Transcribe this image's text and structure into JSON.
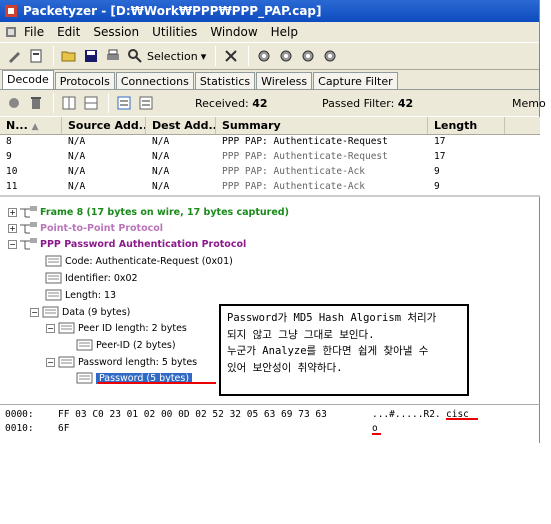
{
  "window": {
    "title": "Packetyzer - [D:₩Work₩PPP₩PPP_PAP.cap]"
  },
  "menu": {
    "items": [
      "File",
      "Edit",
      "Session",
      "Utilities",
      "Window",
      "Help"
    ]
  },
  "toolbar": {
    "selection_label": "Selection"
  },
  "tabs": [
    "Decode",
    "Protocols",
    "Connections",
    "Statistics",
    "Wireless",
    "Capture Filter"
  ],
  "status": {
    "received_label": "Received:",
    "received_value": "42",
    "passed_label": "Passed Filter:",
    "passed_value": "42",
    "memory_label": "Memo"
  },
  "packet_list": {
    "columns": [
      "N...",
      "Source Add...",
      "Dest Add...",
      "Summary",
      "Length"
    ],
    "rows": [
      {
        "no": "8",
        "src": "N/A",
        "dst": "N/A",
        "summary": "PPP PAP: Authenticate-Request",
        "len": "17"
      },
      {
        "no": "9",
        "src": "N/A",
        "dst": "N/A",
        "summary": "PPP PAP: Authenticate-Request",
        "len": "17"
      },
      {
        "no": "10",
        "src": "N/A",
        "dst": "N/A",
        "summary": "PPP PAP: Authenticate-Ack",
        "len": "9"
      },
      {
        "no": "11",
        "src": "N/A",
        "dst": "N/A",
        "summary": "PPP PAP: Authenticate-Ack",
        "len": "9"
      }
    ]
  },
  "tree": {
    "frame": "Frame 8 (17 bytes on wire, 17 bytes captured)",
    "ppp": "Point-to-Point Protocol",
    "pap": "PPP Password Authentication Protocol",
    "code": "Code: Authenticate-Request (0x01)",
    "identifier": "Identifier: 0x02",
    "length": "Length: 13",
    "data": "Data (9 bytes)",
    "peer_id_len": "Peer ID length: 2 bytes",
    "peer_id": "Peer-ID (2 bytes)",
    "pwd_len": "Password length: 5 bytes",
    "password": "Password (5 bytes)"
  },
  "hex": {
    "row1_offset": "0000:",
    "row1_bytes": "FF 03 C0 23 01 02 00 0D 02 52 32 05 63 69 73 63",
    "row1_ascii_a": "...#.....R2.",
    "row1_ascii_b": "cisc",
    "row2_offset": "0010:",
    "row2_bytes": "6F",
    "row2_ascii": "o"
  },
  "annotation": {
    "line1": "Password가 MD5 Hash Algorism 처리가",
    "line2": "되지 않고 그냥 그대로 보인다.",
    "line3": "누군가 Analyze를 한다면 쉽게 찾아낼 수",
    "line4": "있어 보안성이 취약하다."
  },
  "colors": {
    "green_node": "#1a8a1a",
    "purple_node": "#8b1a8b",
    "title_blue": "#0e4bbf",
    "highlight": "#316ac5",
    "red_mark": "#e00000"
  }
}
